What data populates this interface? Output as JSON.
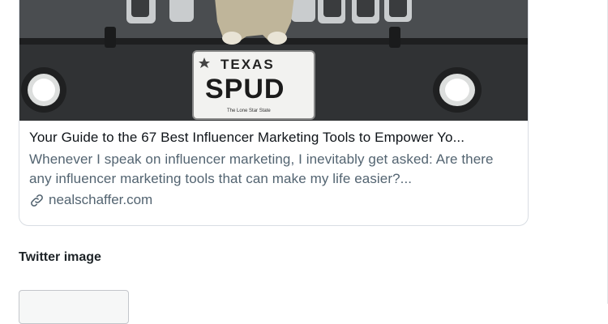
{
  "card": {
    "image_alt": "Dog standing on a jeep bumper with a TEXAS SPUD license plate",
    "plate_state": "TEXAS",
    "plate_text": "SPUD",
    "plate_footer": "The Lone Star State",
    "title": "Your Guide to the 67 Best Influencer Marketing Tools to Empower Yo...",
    "description": "Whenever I speak on influencer marketing, I inevitably get asked: Are there any influencer marketing tools that can make my life easier?...",
    "domain": "nealschaffer.com",
    "domain_icon": "link-icon"
  },
  "twitter_image": {
    "label": "Twitter image",
    "button_label": ""
  },
  "colors": {
    "title": "#0f1419",
    "secondary": "#536471",
    "card_border": "#d9dde3",
    "button_bg": "#f6f7f7"
  }
}
